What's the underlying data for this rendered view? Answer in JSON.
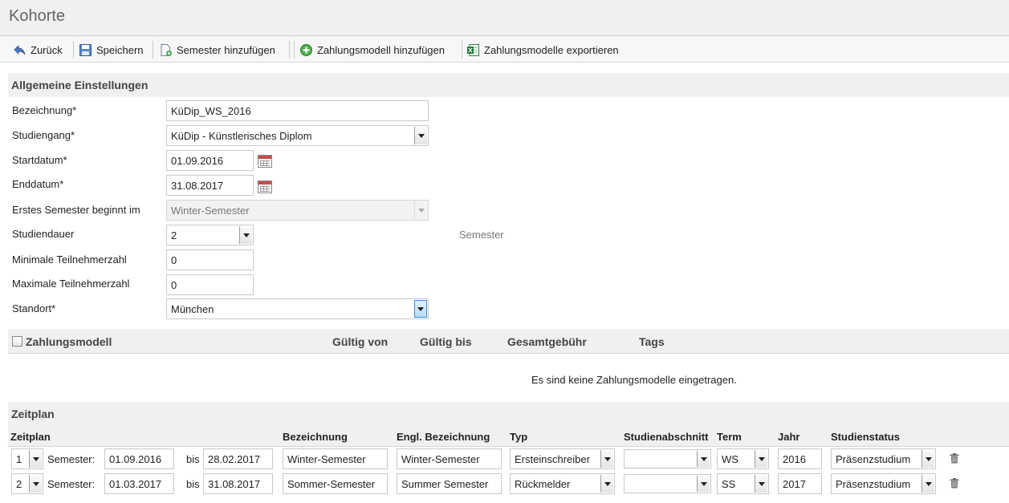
{
  "page": {
    "title": "Kohorte"
  },
  "toolbar": {
    "back": "Zurück",
    "save": "Speichern",
    "add_semester": "Semester hinzufügen",
    "add_payment_model": "Zahlungsmodell hinzufügen",
    "export_payment_models": "Zahlungsmodelle exportieren"
  },
  "general": {
    "heading": "Allgemeine Einstellungen",
    "name_label": "Bezeichnung*",
    "name_value": "KüDip_WS_2016",
    "program_label": "Studiengang*",
    "program_value": "KüDip - Künstlerisches Diplom",
    "start_label": "Startdatum*",
    "start_value": "01.09.2016",
    "end_label": "Enddatum*",
    "end_value": "31.08.2017",
    "first_sem_label": "Erstes Semester beginnt im",
    "first_sem_value": "Winter-Semester",
    "duration_label": "Studiendauer",
    "duration_value": "2",
    "duration_unit": "Semester",
    "min_label": "Minimale Teilnehmerzahl",
    "min_value": "0",
    "max_label": "Maximale Teilnehmerzahl",
    "max_value": "0",
    "location_label": "Standort*",
    "location_value": "München"
  },
  "payment": {
    "col_model": "Zahlungsmodell",
    "col_valid_from": "Gültig von",
    "col_valid_to": "Gültig bis",
    "col_total_fee": "Gesamtgebühr",
    "col_tags": "Tags",
    "empty_text": "Es sind keine Zahlungsmodelle eingetragen."
  },
  "schedule": {
    "heading": "Zeitplan",
    "columns": {
      "schedule": "Zeitplan",
      "name": "Bezeichnung",
      "name_en": "Engl. Bezeichnung",
      "type": "Typ",
      "section": "Studienabschnitt",
      "term": "Term",
      "year": "Jahr",
      "status": "Studienstatus"
    },
    "semester_label": "Semester:",
    "to_label": "bis",
    "rows": [
      {
        "num": "1",
        "from": "01.09.2016",
        "to": "28.02.2017",
        "name": "Winter-Semester",
        "name_en": "Winter-Semester",
        "type": "Ersteinschreiber",
        "section": "",
        "term": "WS",
        "year": "2016",
        "status": "Präsenzstudium"
      },
      {
        "num": "2",
        "from": "01.03.2017",
        "to": "31.08.2017",
        "name": "Sommer-Semester",
        "name_en": "Summer Semester",
        "type": "Rückmelder",
        "section": "",
        "term": "SS",
        "year": "2017",
        "status": "Präsenzstudium"
      }
    ]
  },
  "icons": {
    "back": "back-arrow-icon",
    "save": "floppy-disk-icon",
    "add_semester": "document-add-icon",
    "add_payment_model": "green-plus-circle-icon",
    "export": "excel-export-icon",
    "calendar": "calendar-icon",
    "trash": "trash-icon"
  }
}
